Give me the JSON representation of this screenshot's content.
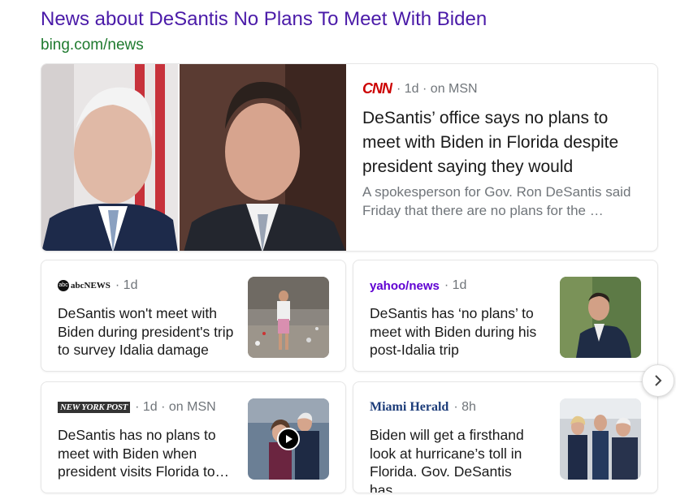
{
  "header": {
    "title": "News about DeSantis No Plans To Meet With Biden",
    "url": "bing.com/news"
  },
  "featured": {
    "source_logo": "CNN",
    "meta": "· 1d · on MSN",
    "headline": "DeSantis’ office says no plans to meet with Biden in Florida despite president saying they would",
    "snippet": "A spokesperson for Gov. Ron DeSantis said Friday that there are no plans for the …",
    "colors": {
      "cnn_red": "#cc0000"
    }
  },
  "cards": [
    {
      "source_logo": "abcNEWS",
      "meta": "· 1d",
      "headline": "DeSantis won't meet with Biden during president's trip to survey Idalia damage"
    },
    {
      "source_logo": "yahoo/news",
      "meta": "· 1d",
      "headline": "DeSantis has ‘no plans’ to meet with Biden during his post-Idalia trip",
      "colors": {
        "yahoo_purple": "#6001d2"
      }
    },
    {
      "source_logo": "NEW YORK POST",
      "meta": "· 1d · on MSN",
      "headline": "DeSantis has no plans to meet with Biden when president visits Florida to…",
      "has_video": true
    },
    {
      "source_logo": "Miami Herald",
      "meta": "· 8h",
      "headline": "Biden will get a firsthand look at hurricane’s toll in Florida. Gov. DeSantis has…",
      "colors": {
        "herald_blue": "#1d3d7a"
      }
    }
  ],
  "icons": {
    "next": "chevron-right-icon",
    "play": "play-icon"
  }
}
